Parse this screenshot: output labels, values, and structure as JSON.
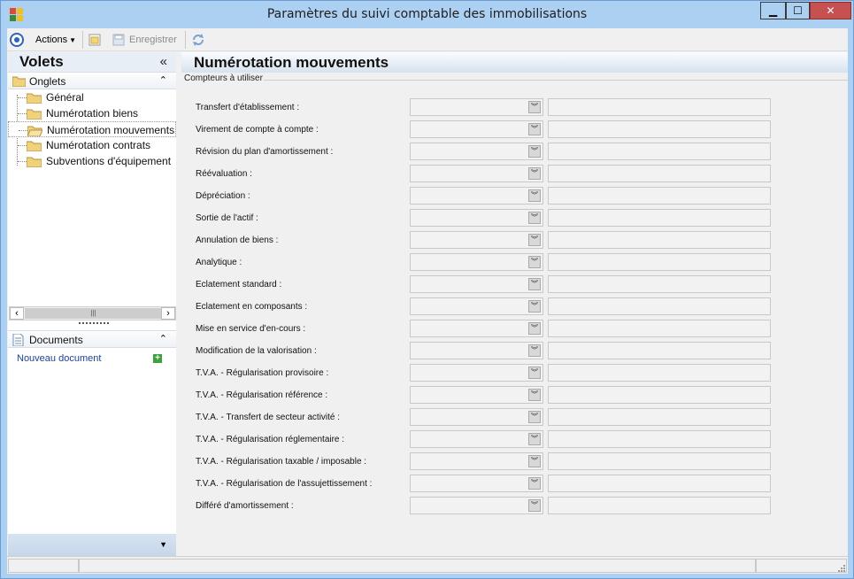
{
  "window": {
    "title": "Paramètres du suivi comptable des immobilisations",
    "controls": {
      "minimize": "▁",
      "maximize": "☐",
      "close": "✕"
    }
  },
  "toolbar": {
    "actions_label": "Actions",
    "save_label": "Enregistrer"
  },
  "left_panel": {
    "title": "Volets",
    "collapse_glyph": "«",
    "onglets": {
      "title": "Onglets",
      "items": [
        {
          "label": "Général"
        },
        {
          "label": "Numérotation biens"
        },
        {
          "label": "Numérotation mouvements"
        },
        {
          "label": "Numérotation contrats"
        },
        {
          "label": "Subventions d'équipement"
        }
      ],
      "selected_index": 2
    },
    "documents": {
      "title": "Documents",
      "new_document": "Nouveau document"
    }
  },
  "main": {
    "title": "Numérotation mouvements",
    "group_label": "Compteurs à utiliser",
    "rows": [
      {
        "label": "Transfert d'établissement :"
      },
      {
        "label": "Virement de compte à compte :"
      },
      {
        "label": "Révision du plan d'amortissement :"
      },
      {
        "label": "Réévaluation :"
      },
      {
        "label": "Dépréciation :"
      },
      {
        "label": "Sortie de l'actif :"
      },
      {
        "label": "Annulation de biens :"
      },
      {
        "label": "Analytique :"
      },
      {
        "label": "Eclatement standard :"
      },
      {
        "label": "Eclatement en composants :"
      },
      {
        "label": "Mise en service d'en-cours :"
      },
      {
        "label": "Modification de la valorisation :"
      },
      {
        "label": "T.V.A. - Régularisation provisoire :"
      },
      {
        "label": "T.V.A. - Régularisation référence :"
      },
      {
        "label": "T.V.A. - Transfert de secteur activité :"
      },
      {
        "label": "T.V.A. - Régularisation réglementaire :"
      },
      {
        "label": "T.V.A. - Régularisation taxable / imposable :"
      },
      {
        "label": "T.V.A. - Régularisation de l'assujettissement :"
      },
      {
        "label": "Différé d'amortissement :"
      }
    ]
  },
  "colors": {
    "titlebar": "#acd0f2",
    "close_button": "#c75050",
    "link": "#1b3fa8"
  }
}
